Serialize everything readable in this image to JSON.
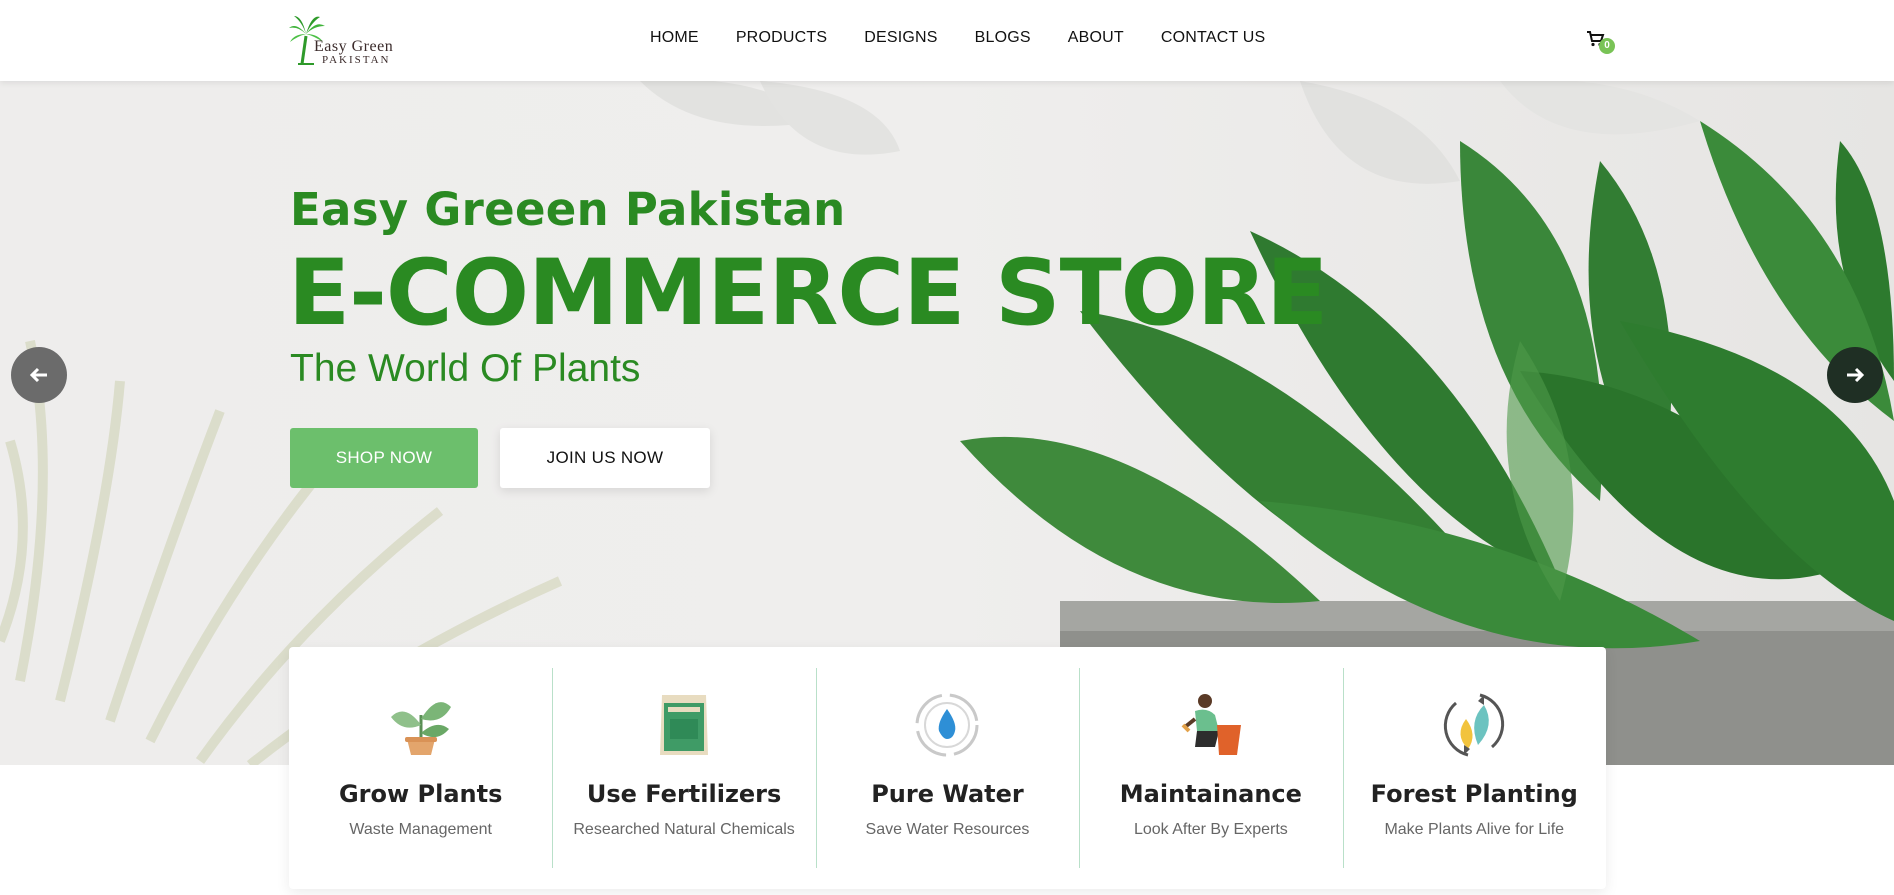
{
  "header": {
    "logo": {
      "line1": "Easy Green",
      "line2": "PAKISTAN"
    },
    "nav": [
      "HOME",
      "PRODUCTS",
      "DESIGNS",
      "BLOGS",
      "ABOUT",
      "CONTACT US"
    ],
    "cart": {
      "icon": "cart-icon",
      "count": "0"
    }
  },
  "hero": {
    "subtitle": "Easy Greeen Pakistan",
    "title": "E-COMMERCE STORE",
    "tagline": "The World Of Plants",
    "shop_button": "SHOP NOW",
    "join_button": "JOIN US NOW",
    "prev_icon": "arrow-left-icon",
    "next_icon": "arrow-right-icon"
  },
  "features": [
    {
      "icon": "potted-plant-icon",
      "title": "Grow Plants",
      "subtitle": "Waste Management"
    },
    {
      "icon": "fertilizer-bag-icon",
      "title": "Use Fertilizers",
      "subtitle": "Researched Natural Chemicals"
    },
    {
      "icon": "water-drop-icon",
      "title": "Pure Water",
      "subtitle": "Save Water Resources"
    },
    {
      "icon": "gardener-icon",
      "title": "Maintainance",
      "subtitle": "Look After By Experts"
    },
    {
      "icon": "leaves-cycle-icon",
      "title": "Forest Planting",
      "subtitle": "Make Plants Alive for Life"
    }
  ],
  "colors": {
    "brand_green": "#2a8a22",
    "button_green": "#6cbf6c",
    "badge_green": "#79c356"
  }
}
